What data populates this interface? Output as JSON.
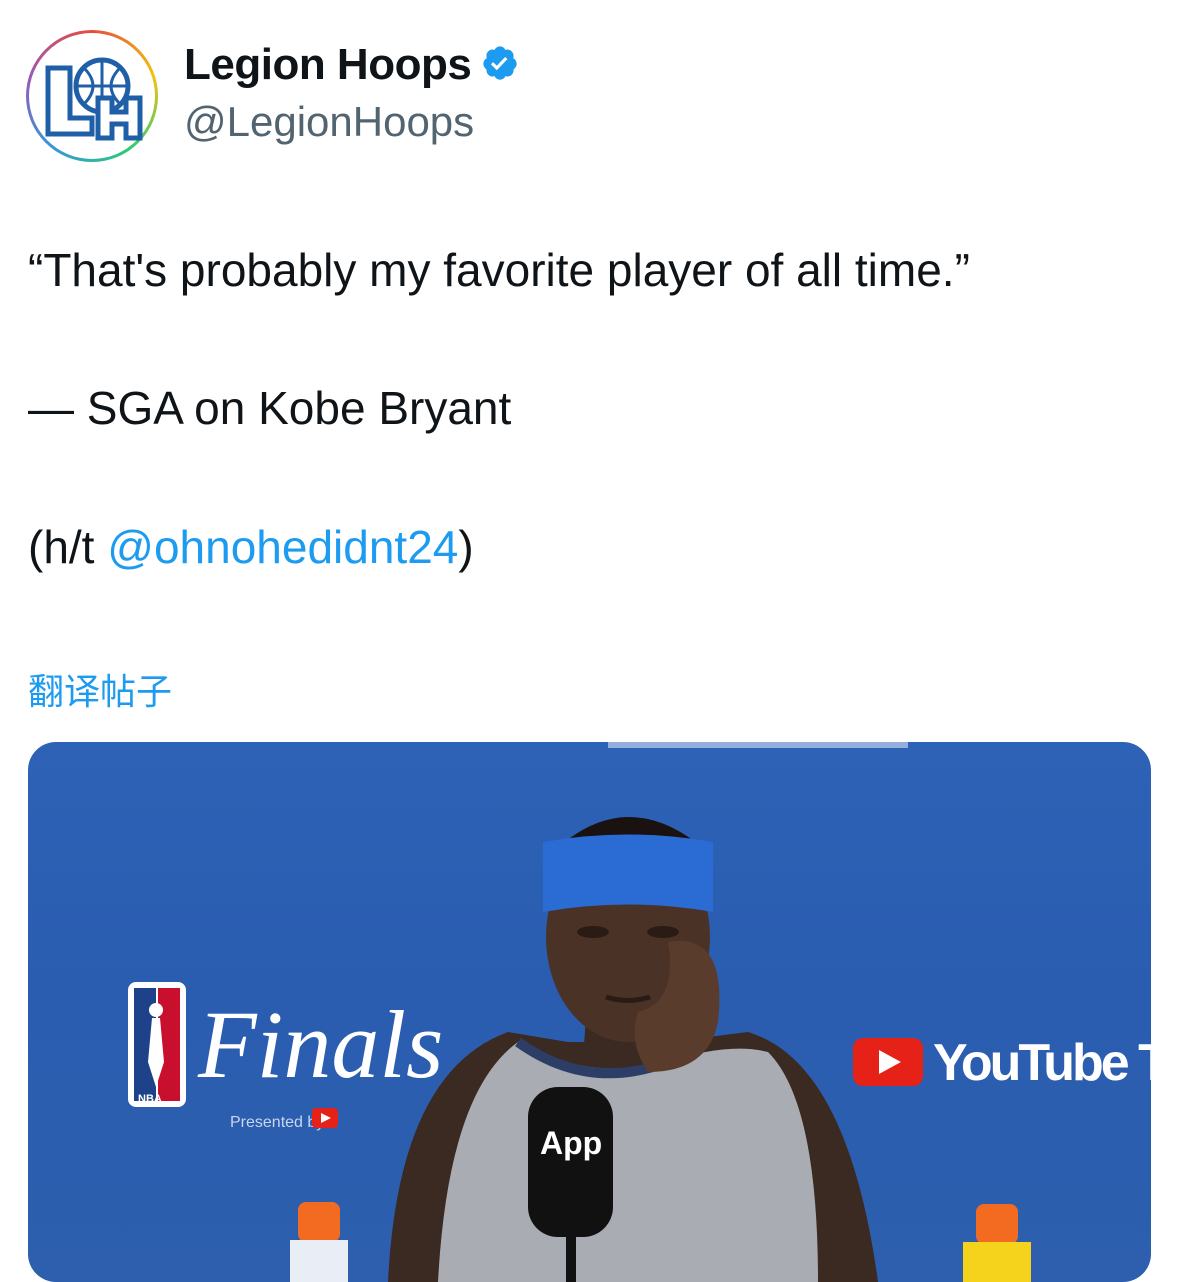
{
  "account": {
    "name": "Legion Hoops",
    "handle": "@LegionHoops",
    "verified": true,
    "avatar_icon": "legion-hoops-logo"
  },
  "tweet": {
    "quote": "“That's probably my favorite player of all time.”",
    "attribution": "— SGA on Kobe Bryant",
    "hat_tip_prefix": "(h/t ",
    "hat_tip_mention": "@ohnohedidnt24",
    "hat_tip_suffix": ")"
  },
  "translate_label": "翻译帖子",
  "media": {
    "backdrop_texts": {
      "finals": "Finals",
      "youtube_tv": "YouTube TV",
      "presented_by": "Presented by",
      "nba": "NBA",
      "mic_label": "App"
    }
  },
  "colors": {
    "accent": "#1d9bf0",
    "secondary_text": "#536471",
    "backdrop_blue": "#2d62b6",
    "youtube_red": "#e62117"
  }
}
